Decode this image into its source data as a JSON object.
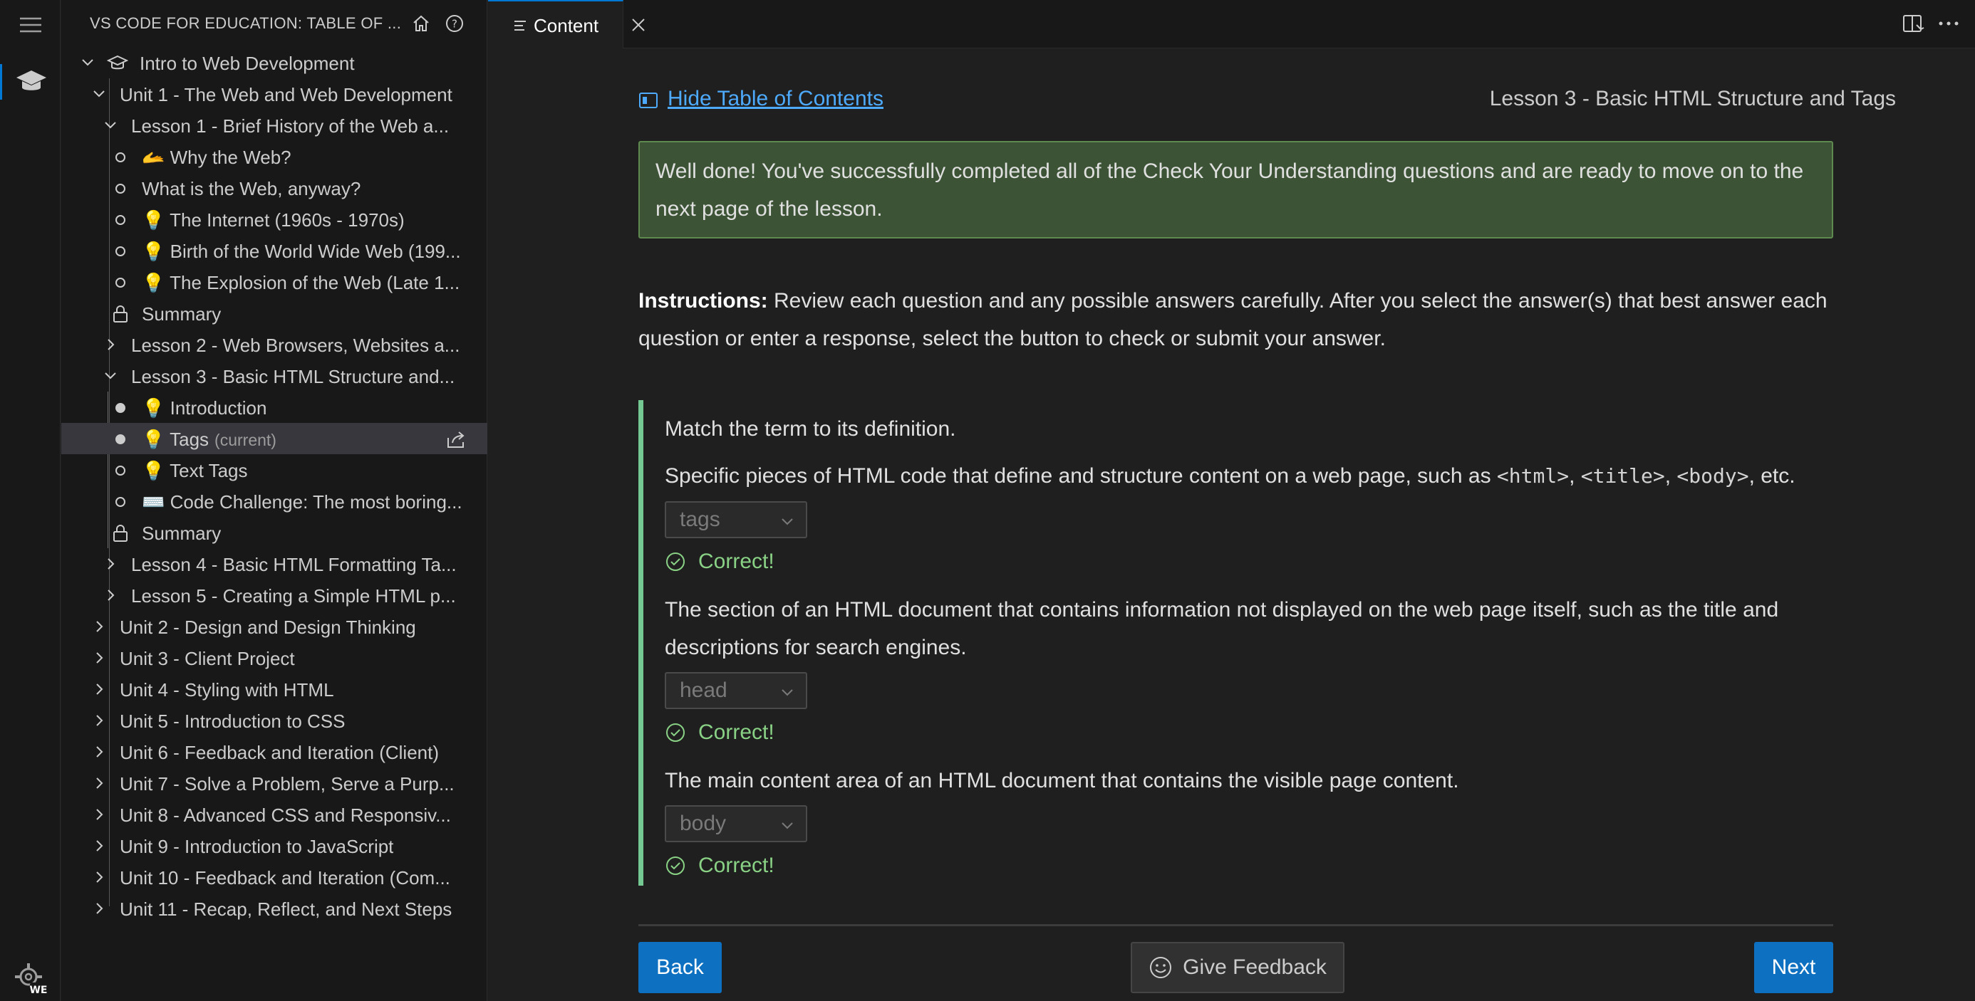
{
  "sidebar": {
    "title": "VS CODE FOR EDUCATION: TABLE OF ...",
    "tree": [
      {
        "label": "Intro to Web Development",
        "icon": "🎓"
      },
      {
        "label": "Unit 1 - The Web and Web Development"
      },
      {
        "label": "Lesson 1 - Brief History of the Web a..."
      },
      {
        "label": "🫴 Why the Web?"
      },
      {
        "label": "What is the Web, anyway?"
      },
      {
        "label": "💡 The Internet (1960s - 1970s)"
      },
      {
        "label": "💡 Birth of the World Wide Web (199..."
      },
      {
        "label": "💡 The Explosion of the Web (Late 1..."
      },
      {
        "label": "Summary"
      },
      {
        "label": "Lesson 2 - Web Browsers, Websites a..."
      },
      {
        "label": "Lesson 3 - Basic HTML Structure and..."
      },
      {
        "label": "💡 Introduction"
      },
      {
        "label": "💡 Tags",
        "suffix": "(current)"
      },
      {
        "label": "💡 Text Tags"
      },
      {
        "label": "⌨️ Code Challenge: The most boring..."
      },
      {
        "label": "Summary"
      },
      {
        "label": "Lesson 4 - Basic HTML Formatting Ta..."
      },
      {
        "label": "Lesson 5 - Creating a Simple HTML p..."
      },
      {
        "label": "Unit 2 - Design and Design Thinking"
      },
      {
        "label": "Unit 3 - Client Project"
      },
      {
        "label": "Unit 4 - Styling with HTML"
      },
      {
        "label": "Unit 5 - Introduction to CSS"
      },
      {
        "label": "Unit 6 - Feedback and Iteration (Client)"
      },
      {
        "label": "Unit 7 - Solve a Problem, Serve a Purp..."
      },
      {
        "label": "Unit 8 - Advanced CSS and Responsiv..."
      },
      {
        "label": "Unit 9 - Introduction to JavaScript"
      },
      {
        "label": "Unit 10 - Feedback and Iteration (Com..."
      },
      {
        "label": "Unit 11 - Recap, Reflect, and Next Steps"
      }
    ]
  },
  "activity": {
    "badge": "WE"
  },
  "tab": {
    "label": "Content"
  },
  "content": {
    "toc_link": "Hide Table of Contents",
    "lesson_title": "Lesson 3 - Basic HTML Structure and Tags",
    "success_message": "Well done! You've successfully completed all of the Check Your Understanding questions and are ready to move on to the next page of the lesson.",
    "instructions_label": "Instructions:",
    "instructions_text": " Review each question and any possible answers carefully. After you select the answer(s) that best answer each question or enter a response, select the button to check or submit your answer.",
    "prompt": "Match the term to its definition.",
    "questions": [
      {
        "text_before": "Specific pieces of HTML code that define and structure content on a web page, such as ",
        "code1": "<html>",
        "sep1": ", ",
        "code2": "<title>",
        "sep2": ", ",
        "code3": "<body>",
        "text_after": ", etc.",
        "answer": "tags",
        "result": "Correct!"
      },
      {
        "text": "The section of an HTML document that contains information not displayed on the web page itself, such as the title and descriptions for search engines.",
        "answer": "head",
        "result": "Correct!"
      },
      {
        "text": "The main content area of an HTML document that contains the visible page content.",
        "answer": "body",
        "result": "Correct!"
      }
    ],
    "buttons": {
      "back": "Back",
      "feedback": "Give Feedback",
      "next": "Next"
    }
  },
  "colors": {
    "accent": "#0e70c0",
    "success_bg": "#3c5336",
    "correct": "#89d185",
    "link": "#4daafc"
  }
}
